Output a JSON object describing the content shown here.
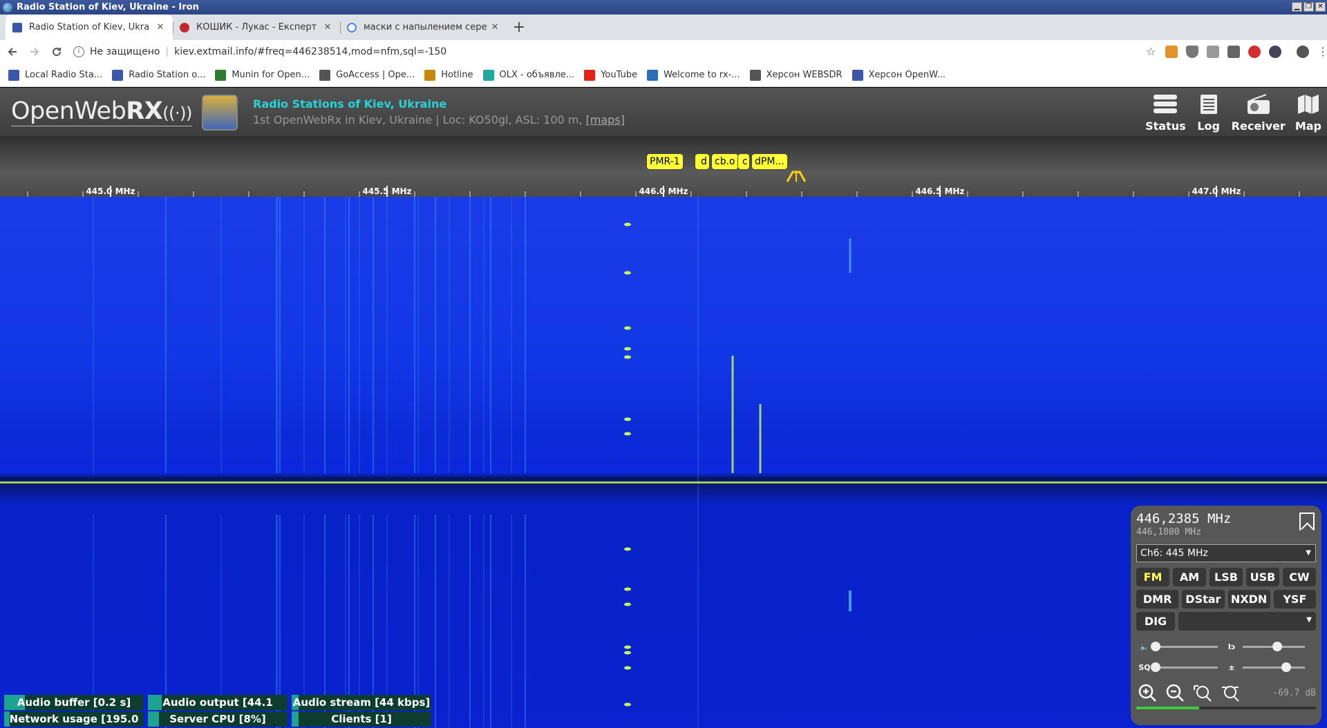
{
  "window": {
    "title": "Radio Station of Kiev, Ukraine - Iron",
    "buttons": [
      "▁",
      "❐",
      "✕"
    ]
  },
  "tabs": [
    {
      "label": "Radio Station of Kiev, Ukra",
      "fav_color": "#3a57a8",
      "active": true
    },
    {
      "label": "КОШИК - Лукас - Експерт",
      "fav_color": "#c1272d",
      "active": false
    },
    {
      "label": "маски с напылением сере",
      "fav_color": "#4285f4",
      "active": false
    }
  ],
  "toolbar": {
    "security_label": "Не защищено",
    "url": "kiev.extmail.info/#freq=446238514,mod=nfm,sql=-150"
  },
  "bookmarks": [
    {
      "label": "Local Radio Sta...",
      "color": "#3a57a8"
    },
    {
      "label": "Radio Station o...",
      "color": "#3a57a8"
    },
    {
      "label": "Munin for Open...",
      "color": "#2e7d32"
    },
    {
      "label": "GoAccess | Ope...",
      "color": "#555555"
    },
    {
      "label": "Hotline",
      "color": "#c8860b"
    },
    {
      "label": "OLX - объявле...",
      "color": "#23a8a0"
    },
    {
      "label": "YouTube",
      "color": "#e62117"
    },
    {
      "label": "Welcome to rx-...",
      "color": "#2a6fb5"
    },
    {
      "label": "Херсон WEBSDR",
      "color": "#555555"
    },
    {
      "label": "Херсон OpenW...",
      "color": "#3a57a8"
    }
  ],
  "header": {
    "logo_text": "OpenWeb",
    "logo_bold": "RX",
    "logo_suffix": "((·))",
    "rx_title": "Radio Stations of Kiev, Ukraine",
    "rx_desc": "1st OpenWebRx in Kiev, Ukraine | Loc: KO50gl, ASL: 100 m,",
    "rx_maps": "[maps]",
    "buttons": [
      {
        "label": "Status",
        "icon": "status-icon"
      },
      {
        "label": "Log",
        "icon": "log-icon"
      },
      {
        "label": "Receiver",
        "icon": "receiver-icon"
      },
      {
        "label": "Map",
        "icon": "map-icon"
      }
    ]
  },
  "scale": {
    "labels": [
      "445.0 MHz",
      "445.5 MHz",
      "446.0 MHz",
      "446.5 MHz",
      "447.0 MHz"
    ],
    "markers": [
      "PMR-1",
      "d",
      "cb.o",
      "c",
      "dPM..."
    ]
  },
  "status": {
    "items": [
      {
        "label": "Audio buffer [0.2 s]",
        "fill": 0.15
      },
      {
        "label": "Audio output [44.1",
        "fill": 0.1
      },
      {
        "label": "Audio stream [44 kbps]",
        "fill": 0.05
      },
      {
        "label": "Network usage [195.0",
        "fill": 0.02
      },
      {
        "label": "Server CPU [8%]",
        "fill": 0.08
      },
      {
        "label": "Clients [1]",
        "fill": 0.05
      }
    ]
  },
  "panel": {
    "freq": "446,2385 MHz",
    "freq_sub": "446,1800 MHz",
    "profile": "Ch6: 445 MHz",
    "modes_row1": [
      "FM",
      "AM",
      "LSB",
      "USB",
      "CW"
    ],
    "modes_row2": [
      "DMR",
      "DStar",
      "NXDN",
      "YSF"
    ],
    "dig": "DIG",
    "squelch_label": "SQ",
    "volume": 0.0,
    "squelch": 0.0,
    "nr": 0.55,
    "agc": 0.7,
    "smeter_db": "-69.7 dB",
    "smeter_level": 0.35,
    "active_mode": "FM"
  }
}
